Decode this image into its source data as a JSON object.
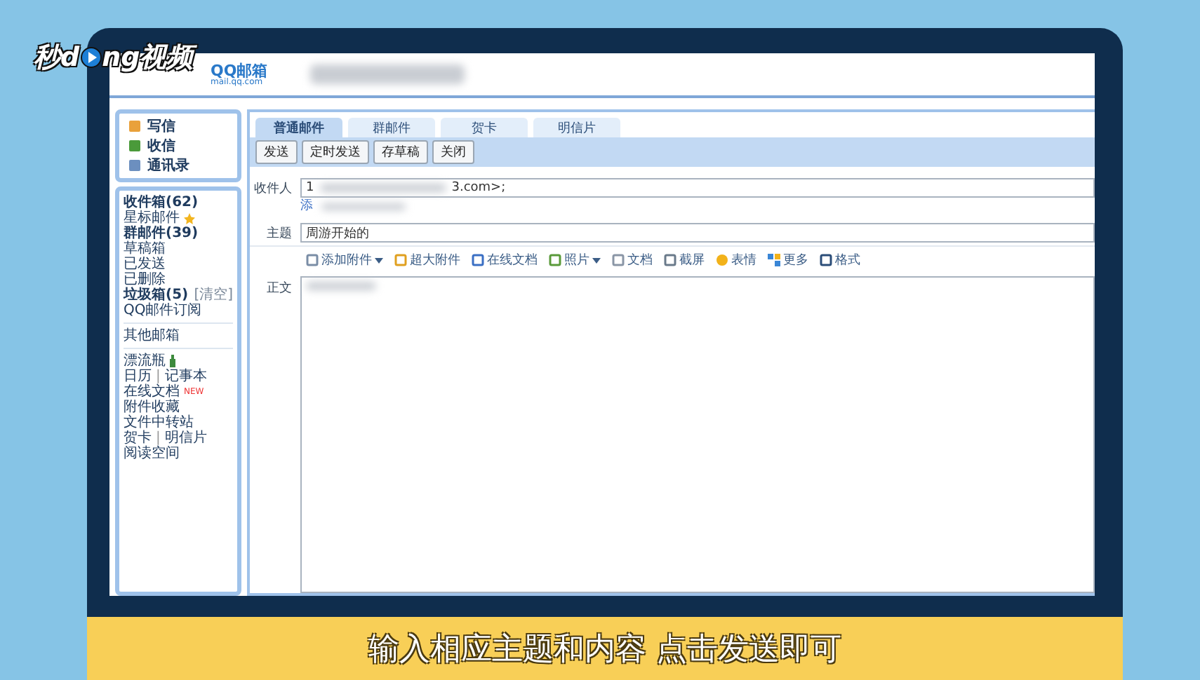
{
  "overlay_logo": {
    "text_a": "秒d",
    "text_b": "ng视频"
  },
  "mail_logo": {
    "name": "QQ邮箱",
    "domain": "mail.qq.com"
  },
  "sidebar": {
    "actions": [
      "写信",
      "收信",
      "通讯录"
    ],
    "folders": [
      {
        "label": "收件箱(62)",
        "bold": true
      },
      {
        "label": "星标邮件",
        "bold": false,
        "star": true
      },
      {
        "label": "群邮件(39)",
        "bold": true
      },
      {
        "label": "草稿箱",
        "bold": false
      },
      {
        "label": "已发送",
        "bold": false
      },
      {
        "label": "已删除",
        "bold": false
      },
      {
        "label": "垃圾箱(5)",
        "bold": true,
        "action": "[清空]"
      },
      {
        "label": "QQ邮件订阅",
        "bold": false
      }
    ],
    "other": "其他邮箱",
    "apps": [
      {
        "labels": [
          "漂流瓶"
        ],
        "bottle": true
      },
      {
        "labels": [
          "日历",
          "记事本"
        ],
        "separator": "|"
      },
      {
        "labels": [
          "在线文档"
        ],
        "badge": "NEW"
      },
      {
        "labels": [
          "附件收藏"
        ]
      },
      {
        "labels": [
          "文件中转站"
        ]
      },
      {
        "labels": [
          "贺卡",
          "明信片"
        ],
        "separator": "|"
      },
      {
        "labels": [
          "阅读空间"
        ]
      }
    ]
  },
  "tabs": [
    {
      "label": "普通邮件",
      "selected": true
    },
    {
      "label": "群邮件",
      "selected": false
    },
    {
      "label": "贺卡",
      "selected": false
    },
    {
      "label": "明信片",
      "selected": false
    }
  ],
  "buttons": [
    "发送",
    "定时发送",
    "存草稿",
    "关闭"
  ],
  "form": {
    "to_label": "收件人",
    "to_start": "1",
    "to_end": "3.com>;",
    "cc_link": "添",
    "subject_label": "主题",
    "subject": "周游开始的",
    "body_label": "正文"
  },
  "toolbar": [
    {
      "kind": "clip",
      "label": "添加附件",
      "menu": true
    },
    {
      "kind": "bigclip",
      "label": "超大附件"
    },
    {
      "kind": "doc",
      "label": "在线文档"
    },
    {
      "kind": "photo",
      "label": "照片",
      "menu": true
    },
    {
      "kind": "file",
      "label": "文档"
    },
    {
      "kind": "cut",
      "label": "截屏"
    },
    {
      "kind": "smile",
      "label": "表情"
    },
    {
      "kind": "more",
      "label": "更多"
    },
    {
      "kind": "format",
      "label": "格式"
    }
  ],
  "caption": "输入相应主题和内容 点击发送即可"
}
